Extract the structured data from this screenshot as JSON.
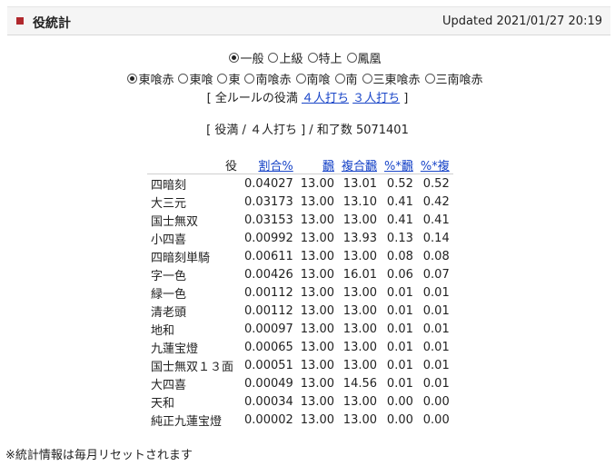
{
  "header": {
    "title": "役統計",
    "updated": "Updated 2021/01/27 20:19"
  },
  "rank_filter": [
    {
      "label": "一般",
      "checked": true
    },
    {
      "label": "上級",
      "checked": false
    },
    {
      "label": "特上",
      "checked": false
    },
    {
      "label": "鳳凰",
      "checked": false
    }
  ],
  "rule_filter": [
    {
      "label": "東喰赤",
      "checked": true
    },
    {
      "label": "東喰",
      "checked": false
    },
    {
      "label": "東",
      "checked": false
    },
    {
      "label": "南喰赤",
      "checked": false
    },
    {
      "label": "南喰",
      "checked": false
    },
    {
      "label": "南",
      "checked": false
    },
    {
      "label": "三東喰赤",
      "checked": false
    },
    {
      "label": "三南喰赤",
      "checked": false
    }
  ],
  "all_rules": {
    "open": "[",
    "label": "全ルールの役満",
    "link_4p": "４人打ち",
    "link_3p": "３人打ち",
    "close": "]"
  },
  "summary": {
    "text": "[ 役満 / ４人打ち ] / 和了数 5071401"
  },
  "table": {
    "headers": {
      "yaku": "役",
      "ratio": "割合%",
      "han": "飜",
      "compound_han": "複合飜",
      "pct_han": "%*飜",
      "pct_compound": "%*複"
    },
    "rows": [
      {
        "yaku": "四暗刻",
        "ratio": "0.04027",
        "han": "13.00",
        "compound_han": "13.01",
        "pct_han": "0.52",
        "pct_compound": "0.52"
      },
      {
        "yaku": "大三元",
        "ratio": "0.03173",
        "han": "13.00",
        "compound_han": "13.10",
        "pct_han": "0.41",
        "pct_compound": "0.42"
      },
      {
        "yaku": "国士無双",
        "ratio": "0.03153",
        "han": "13.00",
        "compound_han": "13.00",
        "pct_han": "0.41",
        "pct_compound": "0.41"
      },
      {
        "yaku": "小四喜",
        "ratio": "0.00992",
        "han": "13.00",
        "compound_han": "13.93",
        "pct_han": "0.13",
        "pct_compound": "0.14"
      },
      {
        "yaku": "四暗刻単騎",
        "ratio": "0.00611",
        "han": "13.00",
        "compound_han": "13.00",
        "pct_han": "0.08",
        "pct_compound": "0.08"
      },
      {
        "yaku": "字一色",
        "ratio": "0.00426",
        "han": "13.00",
        "compound_han": "16.01",
        "pct_han": "0.06",
        "pct_compound": "0.07"
      },
      {
        "yaku": "緑一色",
        "ratio": "0.00112",
        "han": "13.00",
        "compound_han": "13.00",
        "pct_han": "0.01",
        "pct_compound": "0.01"
      },
      {
        "yaku": "清老頭",
        "ratio": "0.00112",
        "han": "13.00",
        "compound_han": "13.00",
        "pct_han": "0.01",
        "pct_compound": "0.01"
      },
      {
        "yaku": "地和",
        "ratio": "0.00097",
        "han": "13.00",
        "compound_han": "13.00",
        "pct_han": "0.01",
        "pct_compound": "0.01"
      },
      {
        "yaku": "九蓮宝燈",
        "ratio": "0.00065",
        "han": "13.00",
        "compound_han": "13.00",
        "pct_han": "0.01",
        "pct_compound": "0.01"
      },
      {
        "yaku": "国士無双１３面",
        "ratio": "0.00051",
        "han": "13.00",
        "compound_han": "13.00",
        "pct_han": "0.01",
        "pct_compound": "0.01"
      },
      {
        "yaku": "大四喜",
        "ratio": "0.00049",
        "han": "13.00",
        "compound_han": "14.56",
        "pct_han": "0.01",
        "pct_compound": "0.01"
      },
      {
        "yaku": "天和",
        "ratio": "0.00034",
        "han": "13.00",
        "compound_han": "13.00",
        "pct_han": "0.00",
        "pct_compound": "0.00"
      },
      {
        "yaku": "純正九蓮宝燈",
        "ratio": "0.00002",
        "han": "13.00",
        "compound_han": "13.00",
        "pct_han": "0.00",
        "pct_compound": "0.00"
      }
    ]
  },
  "footnote": "※統計情報は毎月リセットされます",
  "colors": {
    "accent": "#b0282d",
    "link": "#1a46c8"
  }
}
